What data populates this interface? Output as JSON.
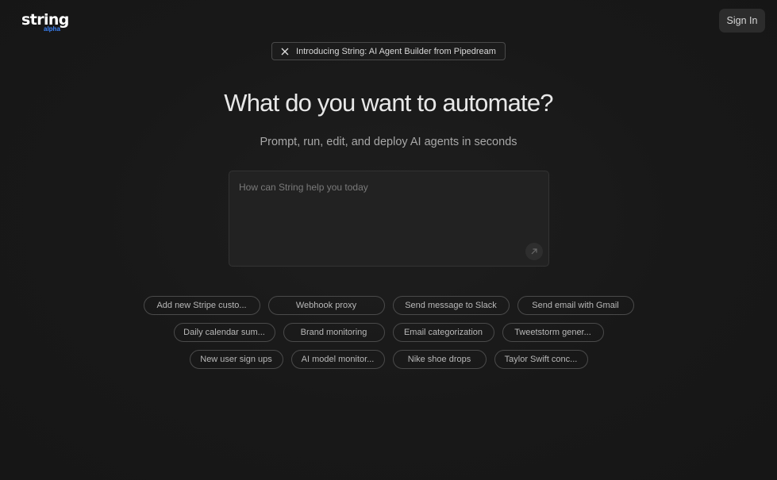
{
  "header": {
    "logo_text": "string",
    "logo_tag": "alpha",
    "signin_label": "Sign In"
  },
  "announcement": {
    "icon": "x-logo-icon",
    "text": "Introducing String: AI Agent Builder from Pipedream"
  },
  "hero": {
    "title": "What do you want to automate?",
    "subtitle": "Prompt, run, edit, and deploy AI agents in seconds"
  },
  "prompt": {
    "placeholder": "How can String help you today",
    "value": "",
    "submit_icon": "arrow-up-right-icon"
  },
  "suggestions": [
    [
      "Add new Stripe custo...",
      "Webhook proxy",
      "Send message to Slack",
      "Send email with Gmail"
    ],
    [
      "Daily calendar sum...",
      "Brand monitoring",
      "Email categorization",
      "Tweetstorm gener..."
    ],
    [
      "New user sign ups",
      "AI model monitor...",
      "Nike shoe drops",
      "Taylor Swift conc..."
    ]
  ],
  "colors": {
    "background": "#181818",
    "accent": "#3b82f6",
    "input_bg": "#222222"
  }
}
